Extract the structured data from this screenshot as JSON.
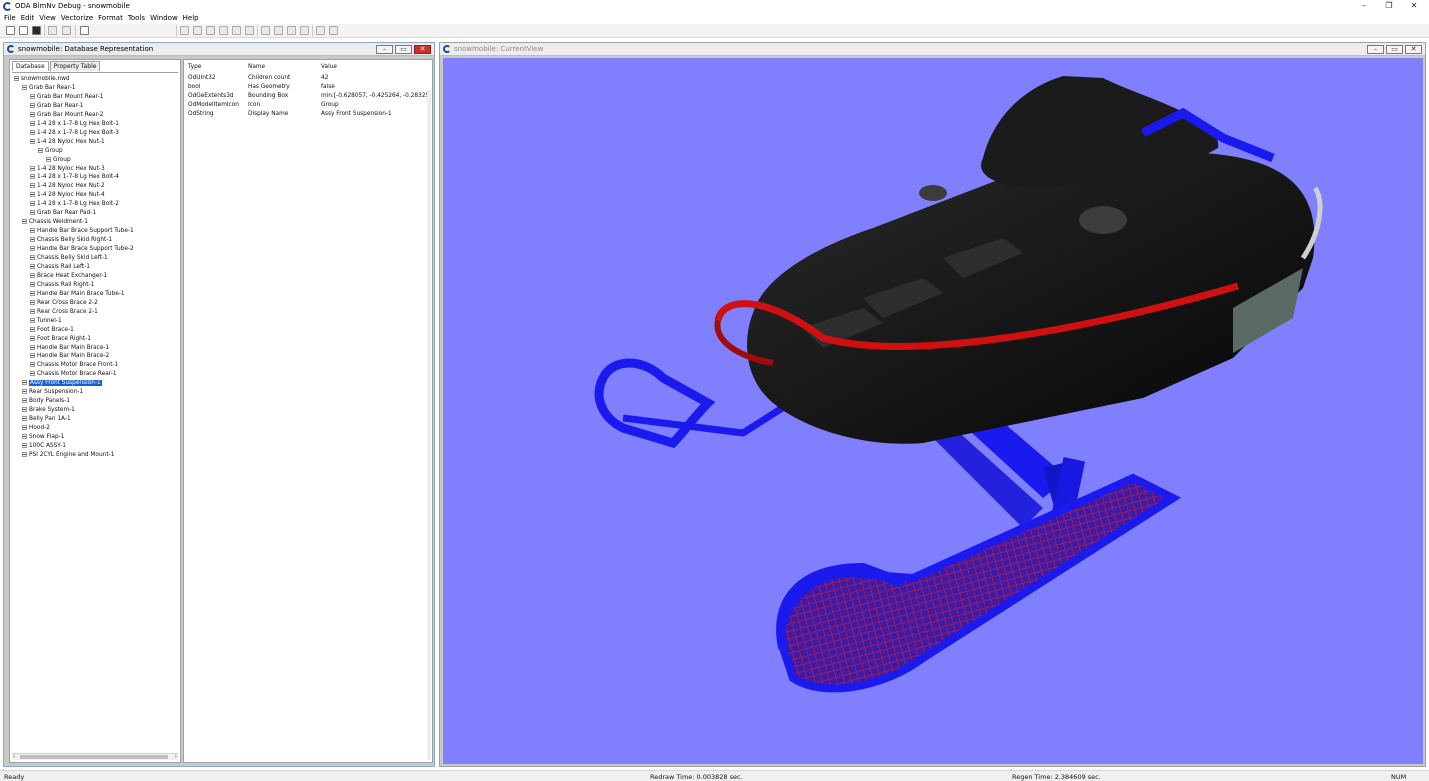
{
  "app": {
    "title": "ODA BimNv Debug - snowmobile"
  },
  "window_controls": {
    "minimize": "–",
    "restore": "❐",
    "close": "✕"
  },
  "menu": [
    "File",
    "Edit",
    "View",
    "Vectorize",
    "Format",
    "Tools",
    "Window",
    "Help"
  ],
  "toolbar": {
    "icons": [
      "new-file-icon",
      "open-file-icon",
      "save-icon",
      "print-icon",
      "print-preview-icon",
      "help-icon",
      "zoom-extents-icon",
      "zoom-in-icon",
      "zoom-out-icon",
      "zoom-window-icon",
      "zoom-previous-icon",
      "orbit-icon",
      "view-box-icon",
      "view-box2-icon",
      "view-box3-icon",
      "view-box4-icon",
      "regen-icon",
      "render-icon"
    ]
  },
  "db_window": {
    "title": "snowmobile: Database Representation",
    "tabs": [
      "Database",
      "Property Table"
    ],
    "tree": [
      {
        "d": 0,
        "label": "snowmobile.nwd"
      },
      {
        "d": 1,
        "label": "Grab Bar Rear-1"
      },
      {
        "d": 2,
        "label": "Grab Bar Mount Rear-1"
      },
      {
        "d": 2,
        "label": "Grab Bar Rear-1"
      },
      {
        "d": 2,
        "label": "Grab Bar Mount Rear-2"
      },
      {
        "d": 2,
        "label": "1-4 28 x 1-7-8 Lg Hex Bolt-1"
      },
      {
        "d": 2,
        "label": "1-4 28 x 1-7-8 Lg Hex Bolt-3"
      },
      {
        "d": 2,
        "label": "1-4 28 Nyloc Hex Nut-1"
      },
      {
        "d": 3,
        "label": "Group"
      },
      {
        "d": 4,
        "label": "Group"
      },
      {
        "d": 2,
        "label": "1-4 28 Nyloc Hex Nut-3"
      },
      {
        "d": 2,
        "label": "1-4 28 x 1-7-8 Lg Hex Bolt-4"
      },
      {
        "d": 2,
        "label": "1-4 28 Nyloc Hex Nut-2"
      },
      {
        "d": 2,
        "label": "1-4 28 Nyloc Hex Nut-4"
      },
      {
        "d": 2,
        "label": "1-4 28 x 1-7-8 Lg Hex Bolt-2"
      },
      {
        "d": 2,
        "label": "Grab Bar Rear Pad-1"
      },
      {
        "d": 1,
        "label": "Chassis Weldment-1"
      },
      {
        "d": 2,
        "label": "Handle Bar Brace Support Tube-1"
      },
      {
        "d": 2,
        "label": "Chassis Belly Skid Right-1"
      },
      {
        "d": 2,
        "label": "Handle Bar Brace Support Tube-2"
      },
      {
        "d": 2,
        "label": "Chassis Belly Skid Left-1"
      },
      {
        "d": 2,
        "label": "Chassis Rail Left-1"
      },
      {
        "d": 2,
        "label": "Brace Heat Exchanger-1"
      },
      {
        "d": 2,
        "label": "Chassis Rail Right-1"
      },
      {
        "d": 2,
        "label": "Handle Bar Main Brace Tube-1"
      },
      {
        "d": 2,
        "label": "Rear Cross Brace 2-2"
      },
      {
        "d": 2,
        "label": "Rear Cross Brace 2-1"
      },
      {
        "d": 2,
        "label": "Tunnel-1"
      },
      {
        "d": 2,
        "label": "Foot Brace-1"
      },
      {
        "d": 2,
        "label": "Foot Brace Right-1"
      },
      {
        "d": 2,
        "label": "Handle Bar Main Brace-1"
      },
      {
        "d": 2,
        "label": "Handle Bar Main Brace-2"
      },
      {
        "d": 2,
        "label": "Chassis Motor Brace Front-1"
      },
      {
        "d": 2,
        "label": "Chassis Motor Brace Rear-1"
      },
      {
        "d": 1,
        "label": "Assy Front Suspension-1",
        "selected": true
      },
      {
        "d": 1,
        "label": "Rear Suspension-1"
      },
      {
        "d": 1,
        "label": "Body Panels-1"
      },
      {
        "d": 1,
        "label": "Brake System-1"
      },
      {
        "d": 1,
        "label": "Belly Pan 1A-1"
      },
      {
        "d": 1,
        "label": "Hood-2"
      },
      {
        "d": 1,
        "label": "Snow Flap-1"
      },
      {
        "d": 1,
        "label": "100C ASSY-1"
      },
      {
        "d": 1,
        "label": "PSI 2CYL Engine and Mount-1"
      }
    ],
    "props": {
      "headers": [
        "Type",
        "Name",
        "Value"
      ],
      "rows": [
        [
          "OdUInt32",
          "Children count",
          "42"
        ],
        [
          "bool",
          "Has Geometry",
          "false"
        ],
        [
          "OdGeExtents3d",
          "Bounding Box",
          "min:[-0.628057, -0.425264, -0.28325..."
        ],
        [
          "OdModelItemIcon",
          "Icon",
          "Group"
        ],
        [
          "OdString",
          "Display Name",
          "Assy Front Suspension-1"
        ]
      ]
    }
  },
  "view_window": {
    "title": "snowmobile: CurrentView"
  },
  "colors": {
    "viewport_bg": "#8080ff",
    "body": "#141414",
    "suspension": "#1a1aee",
    "bumper": "#d01010",
    "selection": "#1561d4"
  },
  "status": {
    "ready": "Ready",
    "redraw": "Redraw Time: 0.003828 sec.",
    "regen": "Regen Time: 2.384609 sec.",
    "num": "NUM"
  }
}
